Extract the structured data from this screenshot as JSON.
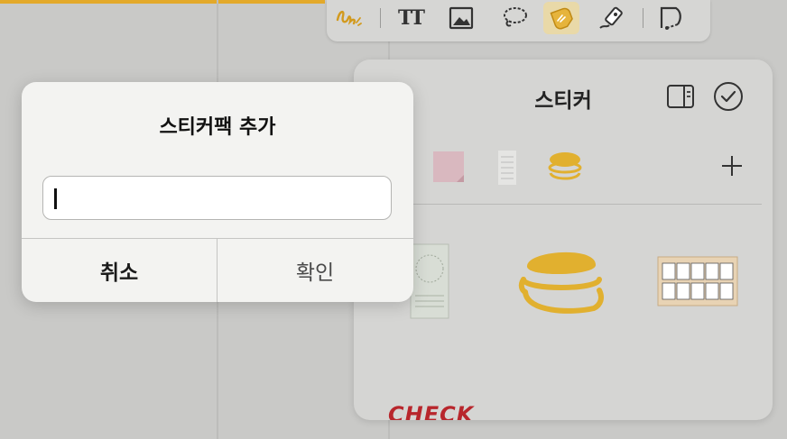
{
  "toolbar": {
    "tools": [
      {
        "name": "pen",
        "icon": "pen-scribble-icon"
      },
      {
        "name": "text",
        "icon": "text-icon",
        "label": "TT"
      },
      {
        "name": "image",
        "icon": "image-icon"
      },
      {
        "name": "lasso",
        "icon": "lasso-icon"
      },
      {
        "name": "sticker",
        "icon": "sticker-icon",
        "active": true
      },
      {
        "name": "highlighter",
        "icon": "highlighter-icon"
      },
      {
        "name": "shape-lasso",
        "icon": "shape-lasso-icon"
      }
    ],
    "accent_color": "#e3a92a"
  },
  "sticker_panel": {
    "title": "스티커",
    "icons": [
      "sidebar-icon",
      "checkmark-circle-icon"
    ],
    "packs": [
      "pink-note-pack",
      "lined-paper-pack",
      "macaron-pack"
    ],
    "add_icon": "plus-icon",
    "bottom_text": "CHECK"
  },
  "dialog": {
    "title": "스티커팩 추가",
    "input_value": "",
    "cancel_label": "취소",
    "confirm_label": "확인"
  }
}
